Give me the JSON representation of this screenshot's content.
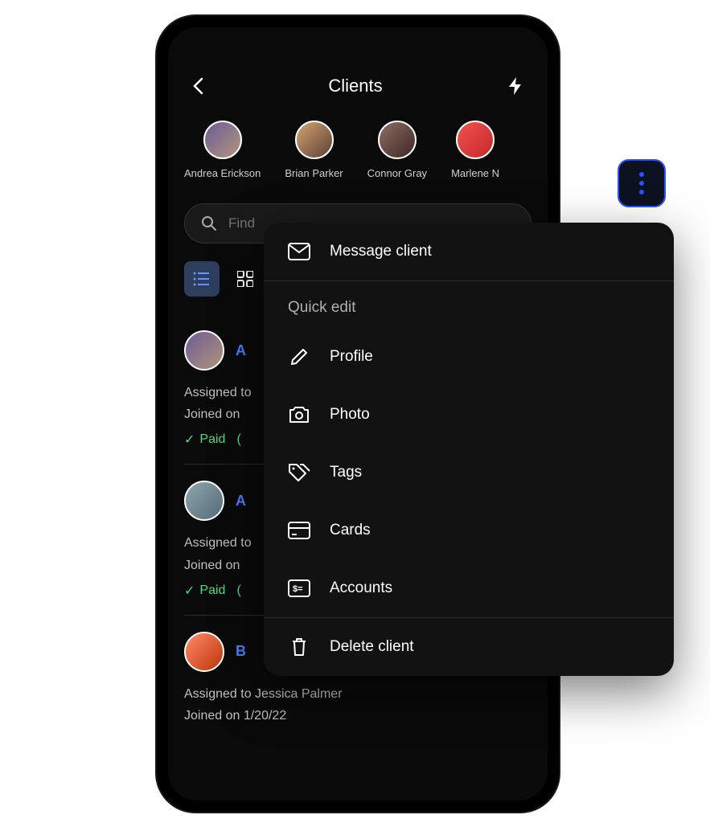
{
  "header": {
    "title": "Clients"
  },
  "clients_row": [
    {
      "name": "Andrea Erickson"
    },
    {
      "name": "Brian Parker"
    },
    {
      "name": "Connor Gray"
    },
    {
      "name": "Marlene N"
    }
  ],
  "search": {
    "placeholder": "Find"
  },
  "client_cards": [
    {
      "name_prefix": "A",
      "assigned_label": "Assigned to",
      "joined_label": "Joined on",
      "paid_label": "Paid"
    },
    {
      "name_prefix": "A",
      "assigned_label": "Assigned to",
      "joined_label": "Joined on",
      "paid_label": "Paid"
    },
    {
      "name_prefix": "B",
      "assigned_to": "Assigned to Jessica Palmer",
      "joined_on": "Joined on 1/20/22"
    }
  ],
  "popover": {
    "message_client": "Message client",
    "quick_edit": "Quick edit",
    "profile": "Profile",
    "photo": "Photo",
    "tags": "Tags",
    "cards": "Cards",
    "accounts": "Accounts",
    "delete_client": "Delete client"
  }
}
